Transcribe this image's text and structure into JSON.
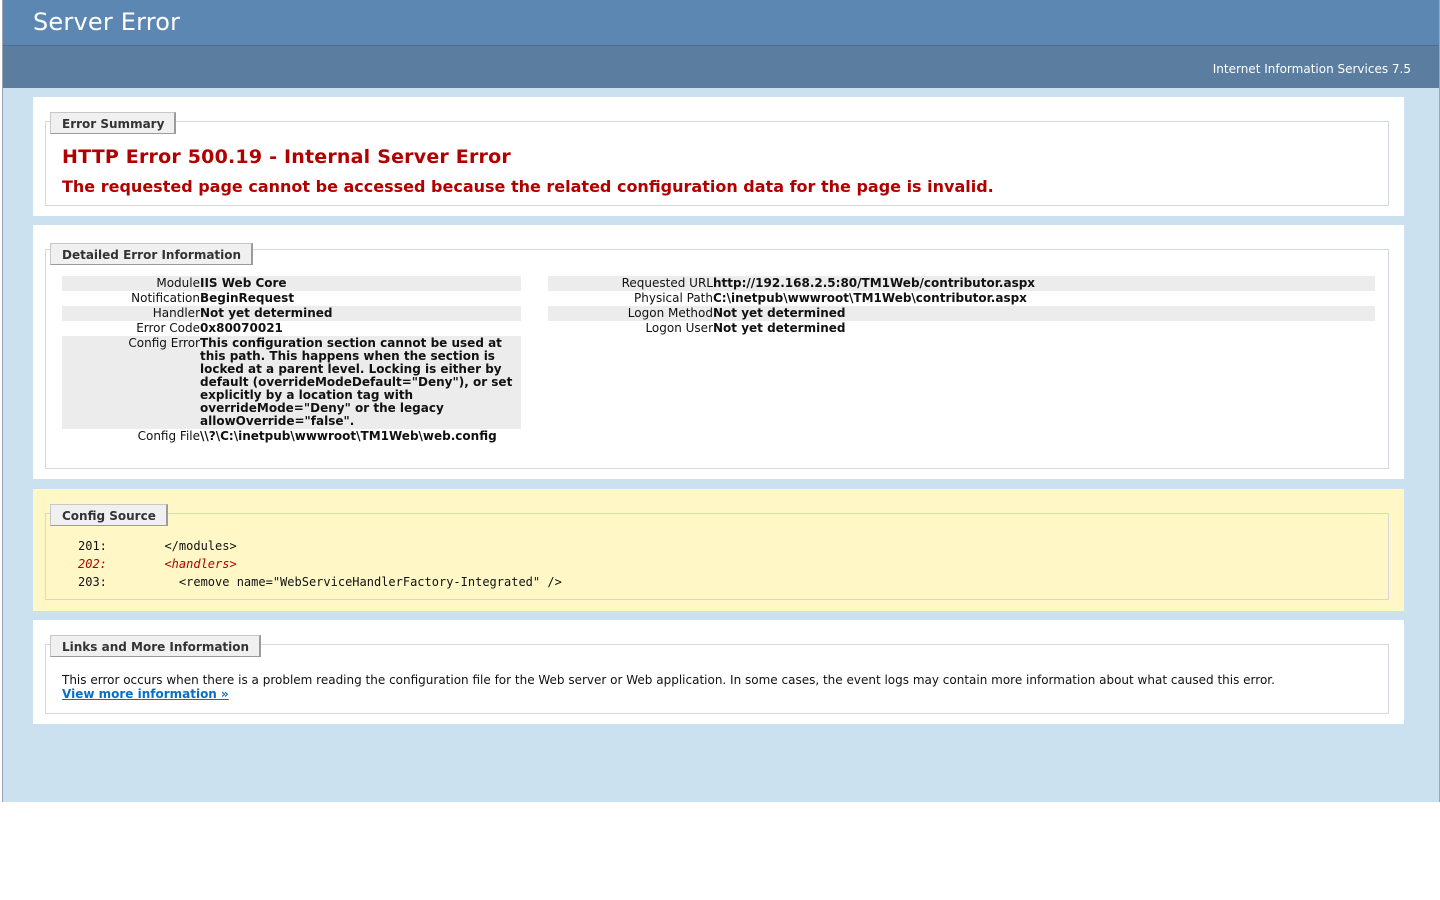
{
  "header": {
    "title": "Server Error",
    "server_version": "Internet Information Services 7.5"
  },
  "summary": {
    "legend": "Error Summary",
    "title": "HTTP Error 500.19 - Internal Server Error",
    "description": "The requested page cannot be accessed because the related configuration data for the page is invalid."
  },
  "details": {
    "legend": "Detailed Error Information",
    "left": [
      {
        "label": "Module",
        "value": "IIS Web Core"
      },
      {
        "label": "Notification",
        "value": "BeginRequest"
      },
      {
        "label": "Handler",
        "value": "Not yet determined"
      },
      {
        "label": "Error Code",
        "value": "0x80070021"
      },
      {
        "label": "Config Error",
        "value": "This configuration section cannot be used at this path. This happens when the section is locked at a parent level. Locking is either by default (overrideModeDefault=\"Deny\"), or set explicitly by a location tag with overrideMode=\"Deny\" or the legacy allowOverride=\"false\"."
      },
      {
        "label": "Config File",
        "value": "\\\\?\\C:\\inetpub\\wwwroot\\TM1Web\\web.config"
      }
    ],
    "right": [
      {
        "label": "Requested URL",
        "value": "http://192.168.2.5:80/TM1Web/contributor.aspx"
      },
      {
        "label": "Physical Path",
        "value": "C:\\inetpub\\wwwroot\\TM1Web\\contributor.aspx"
      },
      {
        "label": "Logon Method",
        "value": "Not yet determined"
      },
      {
        "label": "Logon User",
        "value": "Not yet determined"
      }
    ]
  },
  "config_source": {
    "legend": "Config Source",
    "lines": [
      {
        "num": "201:",
        "code": "  </modules>"
      },
      {
        "num": "202:",
        "code": "  <handlers>"
      },
      {
        "num": "203:",
        "code": "    <remove name=\"WebServiceHandlerFactory-Integrated\" />"
      }
    ]
  },
  "links": {
    "legend": "Links and More Information",
    "text": "This error occurs when there is a problem reading the configuration file for the Web server or Web application. In some cases, the event logs may contain more information about what caused this error.",
    "more_link": "View more information »"
  }
}
